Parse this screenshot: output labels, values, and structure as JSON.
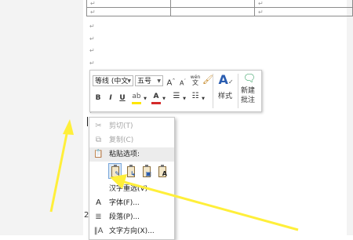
{
  "document": {
    "paragraph_mark": "↵",
    "table_rows": [
      [
        "↵",
        "",
        "↵"
      ],
      [
        "↵",
        "",
        "↵"
      ]
    ],
    "left_marks": [
      "↵",
      "↵",
      "↵",
      "↵",
      "↵",
      "↵",
      "↵",
      "↵",
      "↵",
      "↵",
      "↵",
      "↵",
      "↵",
      "↵",
      "↵",
      "↵",
      "↵"
    ],
    "list_marker": "2"
  },
  "mini_toolbar": {
    "font_name": "等线 (中文",
    "font_size": "五号",
    "grow_font": "A",
    "shrink_font": "A",
    "phonetic": "wén",
    "bold": "B",
    "italic": "I",
    "underline": "U",
    "font_color": "A",
    "styles_label": "样式",
    "new_comment_line1": "新建",
    "new_comment_line2": "批注"
  },
  "context_menu": {
    "cut": "剪切(T)",
    "copy": "复制(C)",
    "paste_options": "粘贴选项:",
    "hanzi_reconvert": "汉字重选(V)",
    "font": "字体(F)...",
    "paragraph": "段落(P)...",
    "text_direction": "文字方向(X)..."
  },
  "colors": {
    "arrow": "#ffef3a",
    "highlight": "#ffe600",
    "font_color": "#d42a2a"
  }
}
